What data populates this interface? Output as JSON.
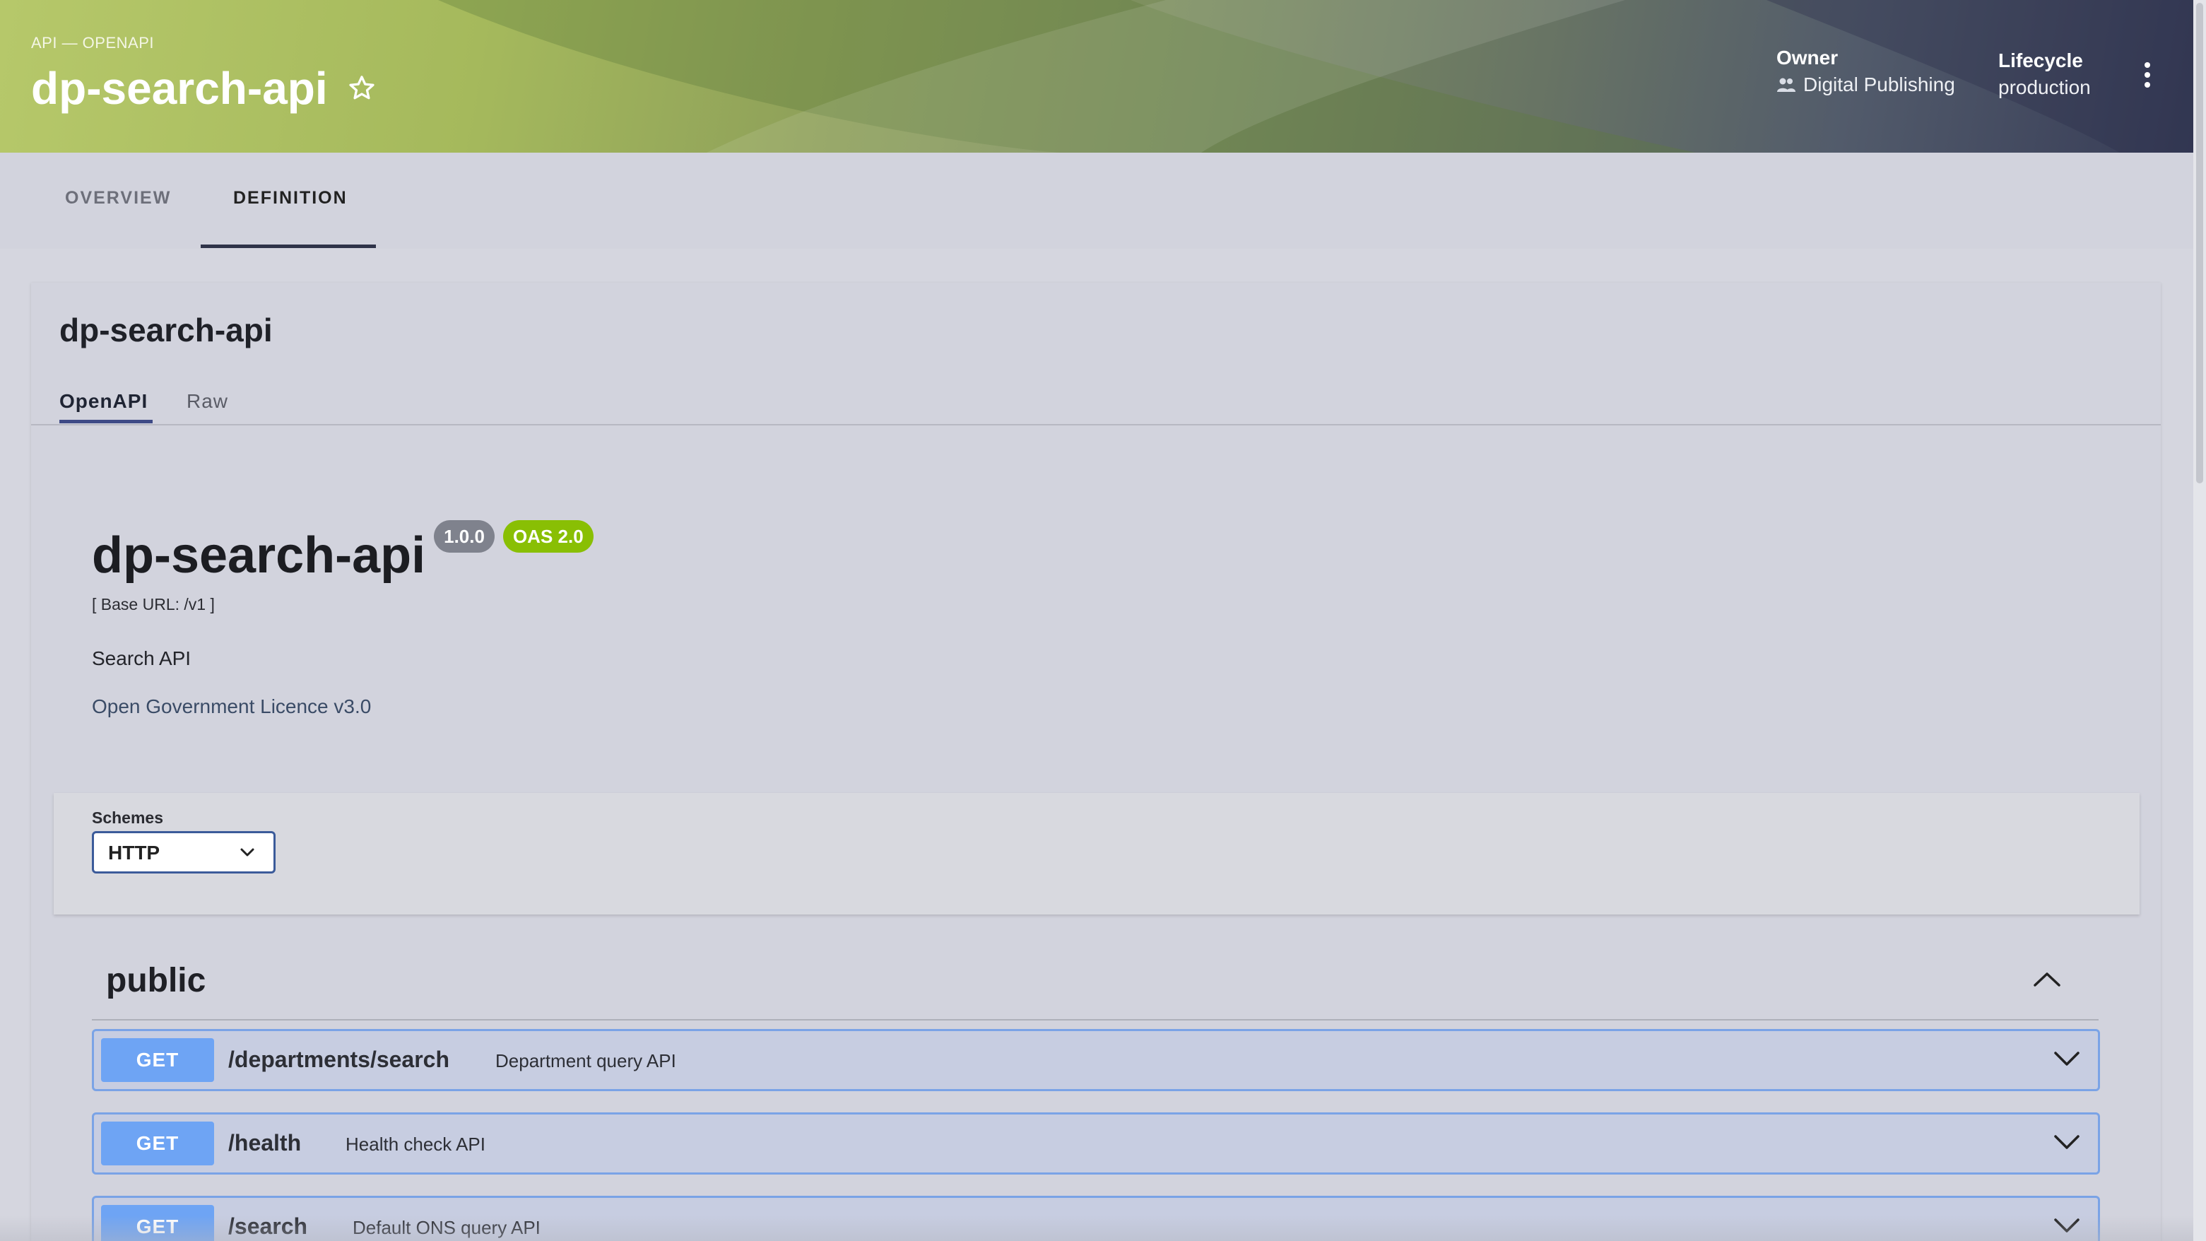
{
  "header": {
    "kind": "API — OPENAPI",
    "title": "dp-search-api",
    "owner_label": "Owner",
    "owner_value": "Digital Publishing",
    "lifecycle_label": "Lifecycle",
    "lifecycle_value": "production",
    "icons": {
      "favorite": "star-outline-icon",
      "owner": "people-icon",
      "menu": "more-vert-icon"
    }
  },
  "tabs": [
    {
      "label": "OVERVIEW",
      "active": false
    },
    {
      "label": "DEFINITION",
      "active": true
    }
  ],
  "definition": {
    "title": "dp-search-api",
    "subtabs": [
      {
        "label": "OpenAPI",
        "active": true
      },
      {
        "label": "Raw",
        "active": false
      }
    ],
    "api": {
      "title": "dp-search-api",
      "version": "1.0.0",
      "oas": "OAS 2.0",
      "base_url": "[ Base URL: /v1 ]",
      "description": "Search API",
      "licence": "Open Government Licence v3.0"
    },
    "schemes": {
      "label": "Schemes",
      "selected": "HTTP"
    },
    "section": {
      "title": "public",
      "expanded": true,
      "operations": [
        {
          "method": "GET",
          "path": "/departments/search",
          "summary": "Department query API"
        },
        {
          "method": "GET",
          "path": "/health",
          "summary": "Health check API"
        },
        {
          "method": "GET",
          "path": "/search",
          "summary": "Default ONS query API"
        }
      ]
    }
  },
  "colors": {
    "header_start": "#b6c86a",
    "header_end": "#363b56",
    "get_method": "#6ea4f4",
    "op_border": "#7aa3e6",
    "oas_badge": "#89bf04",
    "version_badge": "#7f828d"
  }
}
